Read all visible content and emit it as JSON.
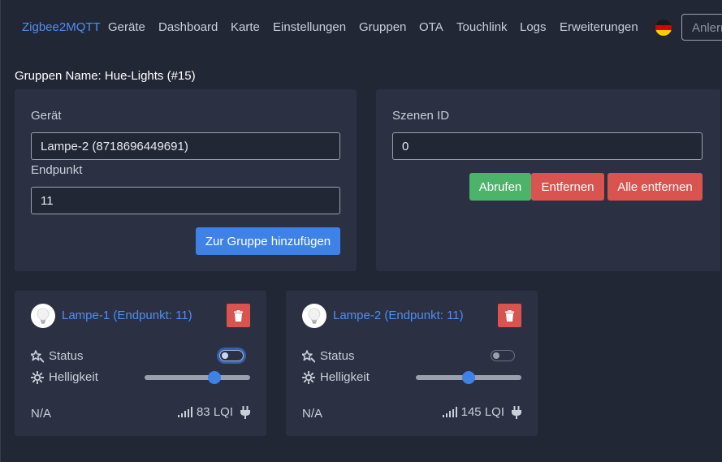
{
  "nav": {
    "brand": "Zigbee2MQTT",
    "links": [
      "Geräte",
      "Dashboard",
      "Karte",
      "Einstellungen",
      "Gruppen",
      "OTA",
      "Touchlink",
      "Logs",
      "Erweiterungen"
    ],
    "search_placeholder": "Anlern",
    "language_flag": "de-flag-icon"
  },
  "page": {
    "title": "Gruppen Name: Hue-Lights (#15)"
  },
  "add_device": {
    "device_label": "Gerät",
    "device_value": "Lampe-2 (8718696449691)",
    "endpoint_label": "Endpunkt",
    "endpoint_value": "11",
    "submit_label": "Zur Gruppe hinzufügen"
  },
  "scenes": {
    "scene_id_label": "Szenen ID",
    "scene_id_value": "0",
    "recall_label": "Abrufen",
    "remove_label": "Entfernen",
    "remove_all_label": "Alle entfernen"
  },
  "members": [
    {
      "title": "Lampe-1 (Endpunkt: 11)",
      "status_label": "Status",
      "status_on": false,
      "brightness_label": "Helligkeit",
      "brightness_fraction": 0.66,
      "last_seen": "N/A",
      "lqi": "83 LQI"
    },
    {
      "title": "Lampe-2 (Endpunkt: 11)",
      "status_label": "Status",
      "status_on": false,
      "brightness_label": "Helligkeit",
      "brightness_fraction": 0.5,
      "last_seen": "N/A",
      "lqi": "145 LQI"
    }
  ],
  "colors": {
    "background": "#222736",
    "panel": "#2b3142",
    "accent": "#3e82e8",
    "brand": "#4f8ef2",
    "success": "#4cb36b",
    "danger": "#d9534f"
  }
}
